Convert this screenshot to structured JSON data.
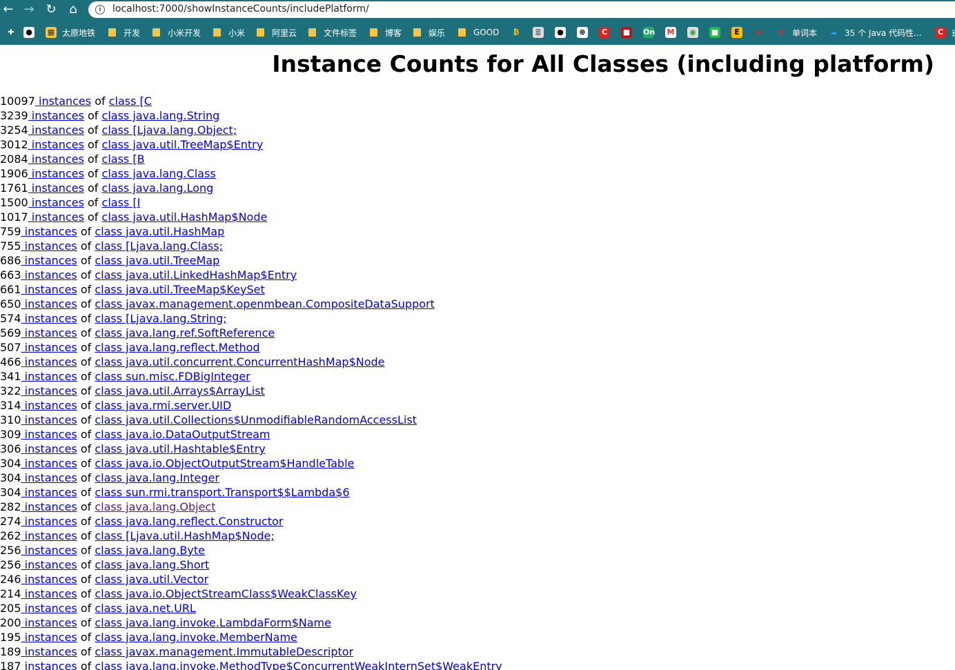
{
  "browser": {
    "url": "localhost:7000/showInstanceCounts/includePlatform/",
    "bookmarks": [
      {
        "icon": "puzzle-icon",
        "label": ""
      },
      {
        "icon": "github-icon",
        "label": ""
      },
      {
        "icon": "bookmark-favicon",
        "label": "太原地铁"
      },
      {
        "icon": "folder-icon",
        "label": "开发"
      },
      {
        "icon": "folder-icon",
        "label": "小米开发"
      },
      {
        "icon": "folder-icon",
        "label": "小米"
      },
      {
        "icon": "folder-icon",
        "label": "阿里云"
      },
      {
        "icon": "folder-icon",
        "label": "文件标签"
      },
      {
        "icon": "folder-icon",
        "label": "博客"
      },
      {
        "icon": "folder-icon",
        "label": "娱乐"
      },
      {
        "icon": "folder-icon",
        "label": "GOOD"
      },
      {
        "icon": "site-favicon",
        "label": ""
      },
      {
        "icon": "db-favicon",
        "label": ""
      },
      {
        "icon": "github-icon",
        "label": ""
      },
      {
        "icon": "ball-favicon",
        "label": ""
      },
      {
        "icon": "csdn-favicon",
        "label": ""
      },
      {
        "icon": "red-favicon",
        "label": ""
      },
      {
        "icon": "on-favicon",
        "label": ""
      },
      {
        "icon": "gmail-favicon",
        "label": ""
      },
      {
        "icon": "green-favicon",
        "label": ""
      },
      {
        "icon": "green2-favicon",
        "label": ""
      },
      {
        "icon": "e-favicon",
        "label": ""
      },
      {
        "icon": "y-favicon",
        "label": ""
      },
      {
        "icon": "y-favicon",
        "label": "单词本"
      },
      {
        "icon": "cloud-favicon",
        "label": "35 个 Java 代码性..."
      },
      {
        "icon": "csdn-favicon",
        "label": "迹"
      }
    ]
  },
  "page": {
    "title": "Instance Counts for All Classes (including platform)",
    "instances_word": " instances",
    "of_word": " of ",
    "rows": [
      {
        "count": "10097",
        "cls": "class [C"
      },
      {
        "count": "3239",
        "cls": "class java.lang.String"
      },
      {
        "count": "3254",
        "cls": "class [Ljava.lang.Object;"
      },
      {
        "count": "3012",
        "cls": "class java.util.TreeMap$Entry"
      },
      {
        "count": "2084",
        "cls": "class [B"
      },
      {
        "count": "1906",
        "cls": "class java.lang.Class"
      },
      {
        "count": "1761",
        "cls": "class java.lang.Long"
      },
      {
        "count": "1500",
        "cls": "class [I"
      },
      {
        "count": "1017",
        "cls": "class java.util.HashMap$Node"
      },
      {
        "count": "759",
        "cls": "class java.util.HashMap"
      },
      {
        "count": "755",
        "cls": "class [Ljava.lang.Class;"
      },
      {
        "count": "686",
        "cls": "class java.util.TreeMap"
      },
      {
        "count": "663",
        "cls": "class java.util.LinkedHashMap$Entry"
      },
      {
        "count": "661",
        "cls": "class java.util.TreeMap$KeySet"
      },
      {
        "count": "650",
        "cls": "class javax.management.openmbean.CompositeDataSupport"
      },
      {
        "count": "574",
        "cls": "class [Ljava.lang.String;"
      },
      {
        "count": "569",
        "cls": "class java.lang.ref.SoftReference"
      },
      {
        "count": "507",
        "cls": "class java.lang.reflect.Method"
      },
      {
        "count": "466",
        "cls": "class java.util.concurrent.ConcurrentHashMap$Node"
      },
      {
        "count": "341",
        "cls": "class sun.misc.FDBigInteger"
      },
      {
        "count": "322",
        "cls": "class java.util.Arrays$ArrayList"
      },
      {
        "count": "314",
        "cls": "class java.rmi.server.UID"
      },
      {
        "count": "310",
        "cls": "class java.util.Collections$UnmodifiableRandomAccessList"
      },
      {
        "count": "309",
        "cls": "class java.io.DataOutputStream"
      },
      {
        "count": "306",
        "cls": "class java.util.Hashtable$Entry"
      },
      {
        "count": "304",
        "cls": "class java.io.ObjectOutputStream$HandleTable"
      },
      {
        "count": "304",
        "cls": "class java.lang.Integer"
      },
      {
        "count": "304",
        "cls": "class sun.rmi.transport.Transport$$Lambda$6"
      },
      {
        "count": "282",
        "cls": "class java.lang.Object",
        "visited": true
      },
      {
        "count": "274",
        "cls": "class java.lang.reflect.Constructor"
      },
      {
        "count": "262",
        "cls": "class [Ljava.util.HashMap$Node;"
      },
      {
        "count": "256",
        "cls": "class java.lang.Byte"
      },
      {
        "count": "256",
        "cls": "class java.lang.Short"
      },
      {
        "count": "246",
        "cls": "class java.util.Vector"
      },
      {
        "count": "214",
        "cls": "class java.io.ObjectStreamClass$WeakClassKey"
      },
      {
        "count": "205",
        "cls": "class java.net.URL"
      },
      {
        "count": "200",
        "cls": "class java.lang.invoke.LambdaForm$Name"
      },
      {
        "count": "195",
        "cls": "class java.lang.invoke.MemberName"
      },
      {
        "count": "189",
        "cls": "class javax.management.ImmutableDescriptor"
      },
      {
        "count": "187",
        "cls": "class java.lang.invoke.MethodType$ConcurrentWeakInternSet$WeakEntry"
      }
    ]
  }
}
